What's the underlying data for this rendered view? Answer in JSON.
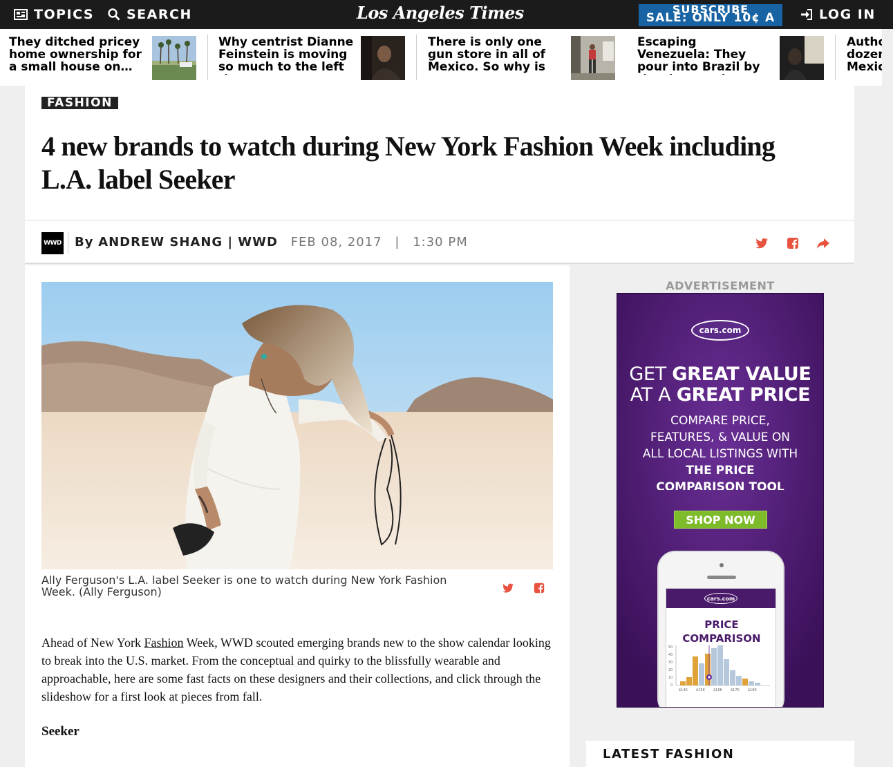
{
  "topbar": {
    "topics_label": "TOPICS",
    "search_label": "SEARCH",
    "logo_text": "Los Angeles Times",
    "subscribe_line1": "SUBSCRIBE",
    "subscribe_line2": "SALE: ONLY 10¢ A",
    "login_label": "LOG IN"
  },
  "headlines": [
    {
      "text": "They ditched pricey home ownership for a small house on…"
    },
    {
      "text": "Why centrist Dianne Feinstein is moving so much to the left tha…"
    },
    {
      "text": "There is only one gun store in all of Mexico. So why is gun…"
    },
    {
      "text": "Escaping Venezuela: They pour into Brazil by the thousands…"
    },
    {
      "text": "Autho dozen Mexic"
    }
  ],
  "article": {
    "section": "FASHION",
    "headline": "4 new brands to watch during New York Fashion Week including L.A. label Seeker",
    "source_logo": "WWD",
    "by": "By",
    "author": "ANDREW SHANG | WWD",
    "date": "FEB 08, 2017",
    "sep": "|",
    "time": "1:30 PM",
    "caption": "Ally Ferguson's L.A. label Seeker is one to watch during New York Fashion Week. (Ally Ferguson)",
    "para_before": "Ahead of New York ",
    "para_link": "Fashion",
    "para_after": " Week, WWD scouted emerging brands new to the show calendar looking to break into the U.S. market. From the conceptual and quirky to the blissfully wearable and approachable, here are some fast facts on these designers and their collections, and click through the slideshow for a first look at pieces from fall.",
    "subhead": "Seeker"
  },
  "share_icons": [
    "twitter-icon",
    "facebook-icon",
    "share-arrow-icon"
  ],
  "ad": {
    "label": "ADVERTISEMENT",
    "brand": "cars.com",
    "head_line1_normal": "GET ",
    "head_line1_bold": "GREAT VALUE",
    "head_line2_normal": "AT A ",
    "head_line2_bold": "GREAT PRICE",
    "sub_line1": "COMPARE PRICE,",
    "sub_line2": "FEATURES, & VALUE ON",
    "sub_line3": "ALL LOCAL LISTINGS WITH",
    "sub_bold1": "THE PRICE",
    "sub_bold2": "COMPARISON TOOL",
    "button": "SHOP NOW",
    "screen_brand": "cars.com",
    "screen_title": "PRICE COMPARISON",
    "y_ticks": [
      "50",
      "40",
      "30",
      "20",
      "10",
      "0"
    ],
    "x_ticks": [
      "$14K",
      "$15K",
      "$16K",
      "$17K",
      "$18K"
    ]
  },
  "colors": {
    "accent_share": "#e8523f",
    "topbar_bg": "#1b1b1b",
    "subscribe_bg": "#1863a3",
    "ad_purple": "#4a1a6a",
    "ad_green": "#7dbb2a",
    "bar_orange": "#e0a33a",
    "bar_blue": "#b6c8dc"
  },
  "rail": {
    "latest_label": "LATEST FASHION"
  }
}
